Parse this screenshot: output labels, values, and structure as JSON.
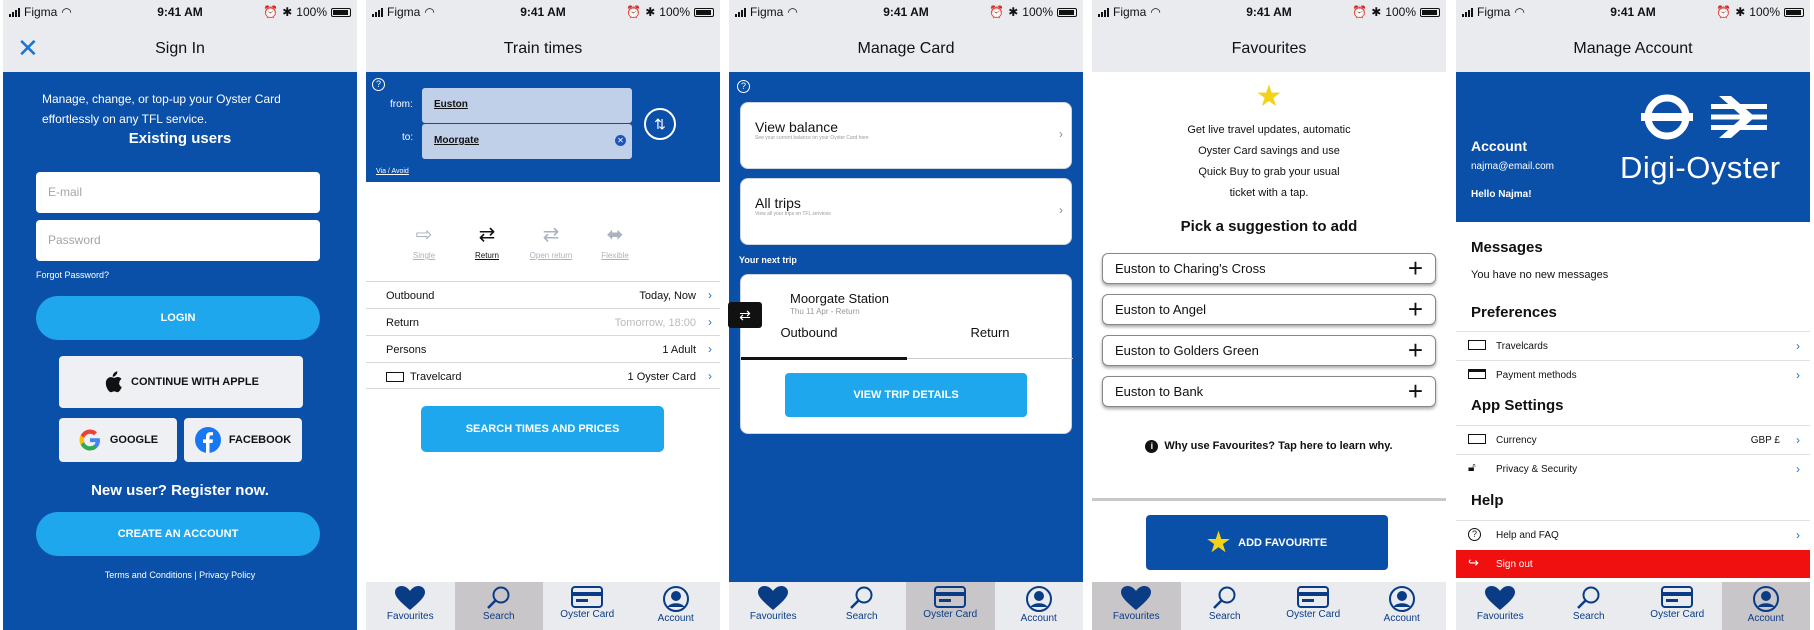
{
  "status": {
    "carrier": "Figma",
    "time": "9:41 AM",
    "battery": "100%"
  },
  "tabs": [
    {
      "label": "Favourites",
      "icon": "heart-icon"
    },
    {
      "label": "Search",
      "icon": "search-icon"
    },
    {
      "label": "Oyster Card",
      "icon": "card-icon"
    },
    {
      "label": "Account",
      "icon": "account-icon"
    }
  ],
  "signin": {
    "title": "Sign In",
    "intro": "Manage, change, or top-up your Oyster Card effortlessly on any TFL service.",
    "existing": "Existing users",
    "email_placeholder": "E-mail",
    "password_placeholder": "Password",
    "forgot": "Forgot Password?",
    "login": "LOGIN",
    "apple": "CONTINUE WITH APPLE",
    "google": "GOOGLE",
    "facebook": "FACEBOOK",
    "new_user": "New user? Register now.",
    "create": "CREATE AN ACCOUNT",
    "terms": "Terms and Conditions | Privacy Policy"
  },
  "train": {
    "title": "Train times",
    "from_label": "from:",
    "from": "Euston",
    "to_label": "to:",
    "to": "Moorgate",
    "via": "Via / Avoid",
    "types": [
      "Single",
      "Return",
      "Open return",
      "Flexible"
    ],
    "rows": [
      {
        "label": "Outbound",
        "value": "Today, Now"
      },
      {
        "label": "Return",
        "value": "Tomorrow, 18:00"
      },
      {
        "label": "Persons",
        "value": "1 Adult"
      },
      {
        "label": "Travelcard",
        "value": "1 Oyster Card"
      }
    ],
    "search": "SEARCH TIMES AND PRICES"
  },
  "manage_card": {
    "title": "Manage Card",
    "balance": "View balance",
    "balance_sub": "See your current balance on your Oyster Card here",
    "trips": "All trips",
    "trips_sub": "View all your trips on TFL services",
    "next": "Your next trip",
    "station": "Moorgate Station",
    "date": "Thu 11 Apr - Return",
    "outbound": "Outbound",
    "return": "Return",
    "details": "VIEW TRIP DETAILS"
  },
  "favourites": {
    "title": "Favourites",
    "desc": [
      "Get live travel updates, automatic",
      "Oyster Card savings and use",
      "Quick Buy to grab your usual",
      "ticket with a tap."
    ],
    "pick": "Pick a suggestion to add",
    "suggestions": [
      "Euston to Charing's Cross",
      "Euston to Angel",
      "Euston to Golders Green",
      "Euston to Bank"
    ],
    "why": "Why use Favourites? Tap here to learn why.",
    "add": "ADD FAVOURITE"
  },
  "account": {
    "title": "Manage Account",
    "heading": "Account",
    "email": "najma@email.com",
    "hello": "Hello Najma!",
    "brand": "Digi-Oyster",
    "messages": "Messages",
    "no_messages": "You have no new messages",
    "preferences": "Preferences",
    "travelcards": "Travelcards",
    "payment": "Payment methods",
    "app_settings": "App Settings",
    "currency": "Currency",
    "currency_value": "GBP £",
    "privacy": "Privacy & Security",
    "help": "Help",
    "faq": "Help and FAQ",
    "signout": "Sign out"
  },
  "colors": {
    "brand_blue": "#0a4fa8",
    "accent": "#1ea7ec",
    "signout_red": "#f01010",
    "star": "#f3d21a"
  }
}
